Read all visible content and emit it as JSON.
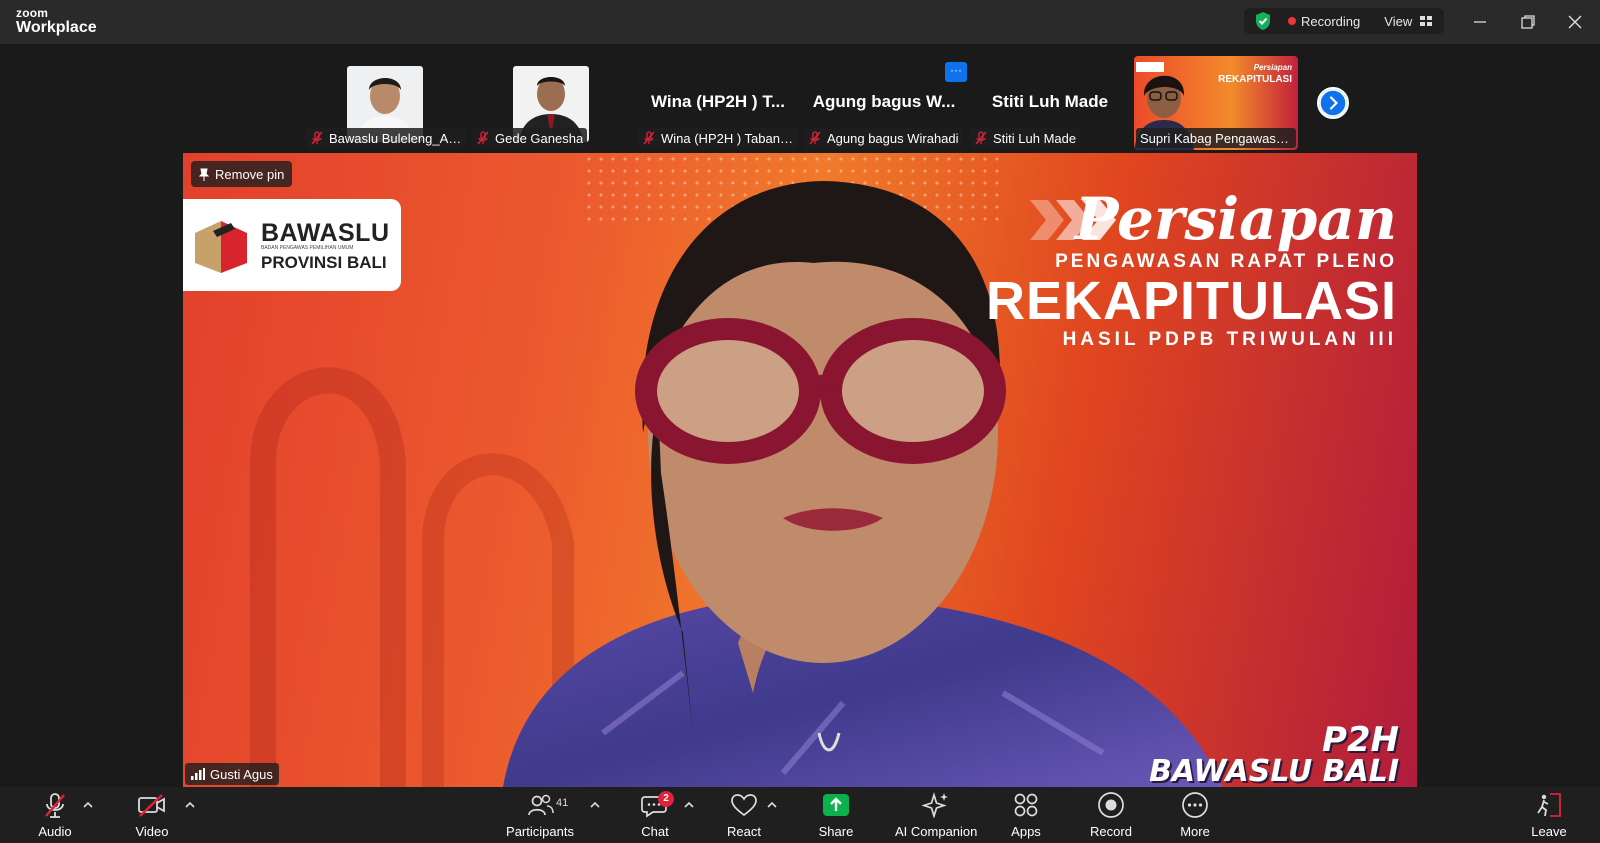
{
  "app": {
    "brand_small": "zoom",
    "brand_large": "Workplace"
  },
  "header": {
    "recording_label": "Recording",
    "view_label": "View"
  },
  "filmstrip": [
    {
      "display": "photo",
      "name": "Bawaslu Buleleng_Agu..."
    },
    {
      "display": "photo",
      "name": "Gede Ganesha"
    },
    {
      "display": "text",
      "big_name": "Wina (HP2H ) T...",
      "name": "Wina (HP2H ) Tabanan ..."
    },
    {
      "display": "text",
      "big_name": "Agung bagus W...",
      "name": "Agung bagus Wirahadi",
      "more_button": "···"
    },
    {
      "display": "text",
      "big_name": "Stiti Luh Made",
      "name": "Stiti Luh Made"
    },
    {
      "display": "video",
      "name": "Supri Kabag Pengawasan ..."
    }
  ],
  "main_video": {
    "pin_label": "Remove pin",
    "speaker_name": "Gusti Agus",
    "background": {
      "org_name": "BAWASLU",
      "org_sub": "BADAN PENGAWAS PEMILIHAN UMUM",
      "org_region": "PROVINSI BALI",
      "title": "Persiapan",
      "line2": "PENGAWASAN RAPAT PLENO",
      "line3": "REKAPITULASI",
      "line4": "HASIL PDPB TRIWULAN III",
      "corner_top": "P2H",
      "corner_bottom": "BAWASLU BALI"
    }
  },
  "toolbar": {
    "audio": "Audio",
    "video": "Video",
    "participants": "Participants",
    "participants_count": "41",
    "chat": "Chat",
    "chat_badge": "2",
    "react": "React",
    "share": "Share",
    "ai_companion": "AI Companion",
    "apps": "Apps",
    "record": "Record",
    "more": "More",
    "leave": "Leave"
  },
  "colors": {
    "accent": "#0e72ed",
    "share": "#0bb24b",
    "record_red": "#f0333a",
    "leave_red": "#e0223a"
  }
}
